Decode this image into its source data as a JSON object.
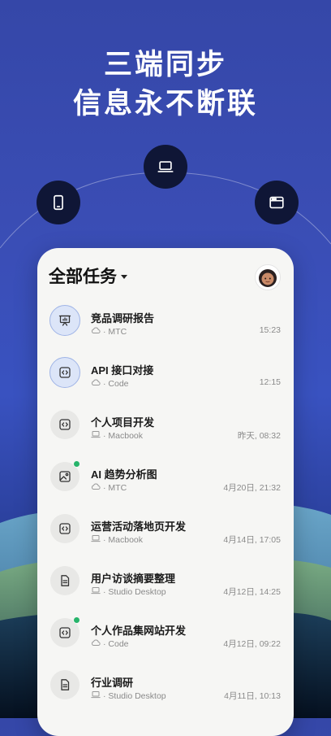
{
  "headline": {
    "line1": "三端同步",
    "line2": "信息永不断联"
  },
  "devices": [
    {
      "name": "phone-icon"
    },
    {
      "name": "laptop-icon"
    },
    {
      "name": "browser-window-icon"
    }
  ],
  "card": {
    "title": "全部任务",
    "tasks": [
      {
        "icon": "presentation-chart-icon",
        "title": "竞品调研报告",
        "source_icon": "cloud-icon",
        "source": "· MTC",
        "time": "15:23",
        "active": true,
        "dot": false
      },
      {
        "icon": "code-icon",
        "title": "API 接口对接",
        "source_icon": "cloud-icon",
        "source": "· Code",
        "time": "12:15",
        "active": true,
        "dot": false
      },
      {
        "icon": "code-icon",
        "title": "个人项目开发",
        "source_icon": "laptop-icon",
        "source": "· Macbook",
        "time": "昨天, 08:32",
        "active": false,
        "dot": false
      },
      {
        "icon": "image-icon",
        "title": "AI 趋势分析图",
        "source_icon": "cloud-icon",
        "source": "· MTC",
        "time": "4月20日, 21:32",
        "active": false,
        "dot": true
      },
      {
        "icon": "code-icon",
        "title": "运营活动落地页开发",
        "source_icon": "laptop-icon",
        "source": "· Macbook",
        "time": "4月14日, 17:05",
        "active": false,
        "dot": false
      },
      {
        "icon": "document-icon",
        "title": "用户访谈摘要整理",
        "source_icon": "laptop-icon",
        "source": "· Studio Desktop",
        "time": "4月12日, 14:25",
        "active": false,
        "dot": false
      },
      {
        "icon": "code-icon",
        "title": "个人作品集网站开发",
        "source_icon": "cloud-icon",
        "source": "· Code",
        "time": "4月12日, 09:22",
        "active": false,
        "dot": true
      },
      {
        "icon": "document-icon",
        "title": "行业调研",
        "source_icon": "laptop-icon",
        "source": "· Studio Desktop",
        "time": "4月11日, 10:13",
        "active": false,
        "dot": false
      }
    ]
  },
  "colors": {
    "accent_green": "#27b46b",
    "active_ring": "#9fb4e6",
    "active_bg": "#dce5f8"
  }
}
